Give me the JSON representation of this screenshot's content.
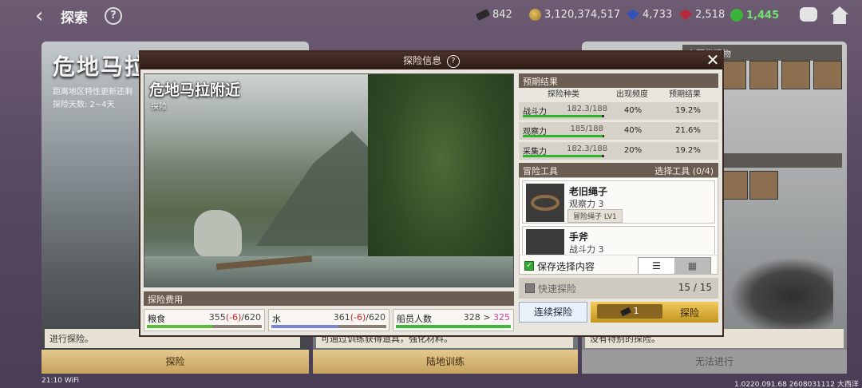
{
  "topbar": {
    "title": "探索",
    "help": "?",
    "resources": [
      {
        "icon": "ticket-icon",
        "value": "842"
      },
      {
        "icon": "gold-coin-icon",
        "value": "3,120,374,517"
      },
      {
        "icon": "sapphire-icon",
        "value": "4,733"
      },
      {
        "icon": "ruby-icon",
        "value": "2,518"
      },
      {
        "icon": "gear-token-icon",
        "value": "1,445"
      }
    ]
  },
  "background": {
    "left_title": "危地马拉",
    "left_sub1": "距离地区特性更新还剩",
    "left_sub2": "探险天数: 2~4天",
    "left_desc": "进行探险。",
    "mid_desc": "可通过训练获得道具，强化材料。",
    "right_header1": "主要发现物",
    "right_header2": "动",
    "right_desc": "没有特别的探险。",
    "btn_explore": "探险",
    "btn_land_training": "陆地训练",
    "btn_unavailable": "无法进行"
  },
  "modal": {
    "title": "探险信息",
    "help": "?",
    "close": "✕",
    "scene_title": "危地马拉附近",
    "scene_sub": "探险",
    "cost": {
      "header": "探险费用",
      "items": [
        {
          "label": "粮食",
          "current": "355",
          "delta": "(-6)",
          "max": "/620",
          "fill": 0.57,
          "color": "#5cbd3a",
          "rest": "#8a7e76"
        },
        {
          "label": "水",
          "current": "361",
          "delta": "(-6)",
          "max": "/620",
          "fill": 0.58,
          "color": "#7a86d6",
          "rest": "#8a7e76"
        },
        {
          "label": "船员人数",
          "current": "328",
          "arrow": " > ",
          "next": "325",
          "fill": 1.0,
          "color": "#3db83a"
        }
      ]
    },
    "expected": {
      "header": "预期结果",
      "columns": [
        "探险种类",
        "出现频度",
        "预期结果"
      ],
      "rows": [
        {
          "name": "战斗力",
          "stat": "182.3/188",
          "freq": "40%",
          "result": "19.2%",
          "fill": 0.97
        },
        {
          "name": "观察力",
          "stat": "185/188",
          "freq": "40%",
          "result": "21.6%",
          "fill": 0.98
        },
        {
          "name": "采集力",
          "stat": "182.3/188",
          "freq": "20%",
          "result": "19.2%",
          "fill": 0.97
        }
      ]
    },
    "tools": {
      "header": "冒险工具",
      "select_label": "选择工具 (0/4)",
      "items": [
        {
          "name": "老旧绳子",
          "stat": "观察力 3",
          "tag": "冒险绳子 LV1"
        },
        {
          "name": "手斧",
          "stat": "战斗力 3"
        }
      ],
      "save_label": "保存选择内容"
    },
    "quick": {
      "label": "快速探险",
      "count": "15 / 15"
    },
    "btn_continuous": "连续探险",
    "btn_go_cost": "1",
    "btn_go": "探险"
  },
  "status": {
    "time": "21:10",
    "wifi": "WiFi",
    "version": "1.0220.091.68 2608031112 大西洋"
  }
}
